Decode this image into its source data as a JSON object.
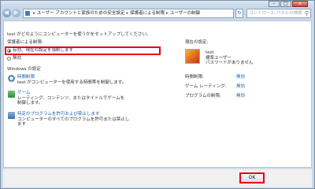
{
  "window": {
    "minimize_glyph": "–",
    "maximize_glyph": "□",
    "close_glyph": "x"
  },
  "nav": {
    "back_glyph": "◀",
    "forward_glyph": "▶",
    "dropdown_glyph": "▾"
  },
  "breadcrumb": [
    "ユーザー アカウントと家族のための安全設定",
    "保護者による制限",
    "ユーザーの制御"
  ],
  "breadcrumb_separator": "▸",
  "search": {
    "placeholder": "コントロール パネルの検索",
    "icon": "magnifier-icon"
  },
  "refresh_glyph": "↻",
  "main": {
    "intro": "test がどのようにコンピューターを使うかをセットアップしてください。",
    "parental_heading": "保護者による制限:",
    "radio_on": "有効、現在の設定を強制します",
    "radio_off": "無効",
    "windows_heading": "Windows の設定",
    "settings": [
      {
        "title": "時間制限",
        "desc1": "test がコンピューターを使用する時間帯を制御します。",
        "desc2": "",
        "icon": "clock-icon"
      },
      {
        "title": "ゲーム",
        "desc1": "レーティング、コンテンツ、またはタイトルでゲームを",
        "desc2": "制御します。",
        "icon": "game-icon"
      },
      {
        "title": "特定のプログラムを許可および禁止します",
        "desc1": "コンピューターのすべてのプログラムを許可または禁止し",
        "desc2": "ます",
        "icon": "program-icon"
      }
    ],
    "current_heading": "現在の設定:",
    "user_name": "test",
    "user_type": "標準ユーザー",
    "user_password": "パスワードがありません",
    "status": [
      {
        "label": "時間制限:",
        "value": "無効"
      },
      {
        "label": "ゲーム レーティング:",
        "value": "無効"
      },
      {
        "label": "プログラムの制限:",
        "value": "無効"
      }
    ]
  },
  "ok_label": "OK"
}
